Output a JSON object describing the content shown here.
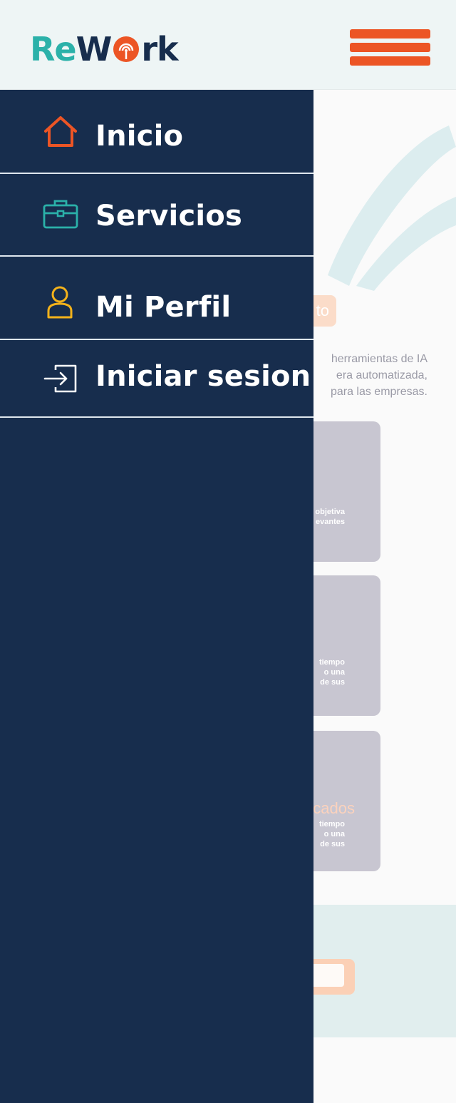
{
  "header": {
    "logo": {
      "part1": "Re",
      "part2": "W",
      "part3": "rk"
    },
    "menu_button": {
      "icon": "hamburger-menu-icon"
    }
  },
  "drawer": {
    "items": [
      {
        "label": "Inicio",
        "icon": "home-icon",
        "color": "#ec5525"
      },
      {
        "label": "Servicios",
        "icon": "briefcase-icon",
        "color": "#2bb1a9"
      },
      {
        "label": "Mi Perfil",
        "icon": "user-icon",
        "color": "#f3b21b"
      },
      {
        "label": "Iniciar sesion",
        "icon": "sign-in-icon",
        "color": "#ffffff"
      }
    ]
  },
  "background": {
    "pill_text": "to",
    "intro_lines": [
      "herramientas de IA",
      "era automatizada,",
      "para las empresas."
    ],
    "cards": [
      {
        "text": "objetiva\nevantes"
      },
      {
        "text": "tiempo\no una\nde sus"
      },
      {
        "heading": "cados",
        "text": "tiempo\no una\nde sus"
      }
    ]
  },
  "colors": {
    "drawer_bg": "#172d4d",
    "accent_orange": "#ec5525",
    "accent_teal": "#2bb1a9",
    "accent_yellow": "#f3b21b"
  }
}
